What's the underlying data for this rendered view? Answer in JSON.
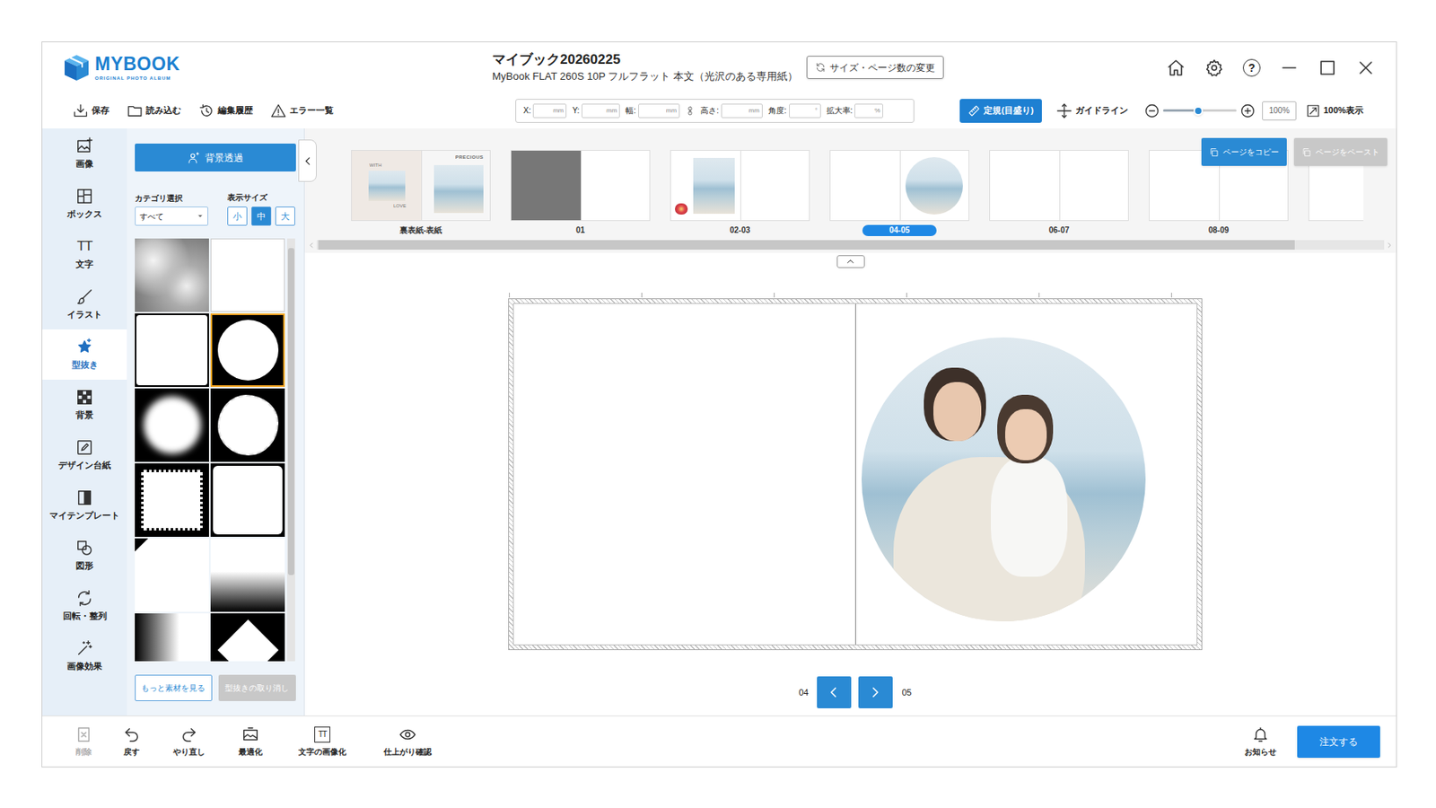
{
  "app": {
    "logo": "MYBOOK",
    "tagline": "ORIGINAL PHOTO ALBUM"
  },
  "window": {
    "title": "マイブック20260225",
    "subtitle": "MyBook FLAT 260S 10P フルフラット 本文（光沢のある専用紙）",
    "resize_button": "サイズ・ページ数の変更",
    "help": "?"
  },
  "toolbar": {
    "actions": [
      {
        "label": "保存",
        "kind": "save"
      },
      {
        "label": "読み込む",
        "kind": "open"
      },
      {
        "label": "編集履歴",
        "kind": "history"
      },
      {
        "label": "エラー一覧",
        "kind": "error"
      }
    ],
    "fields": [
      {
        "label": "X:",
        "unit": "mm",
        "value": ""
      },
      {
        "label": "Y:",
        "unit": "mm",
        "value": ""
      },
      {
        "label": "幅:",
        "unit": "mm",
        "value": ""
      },
      {
        "label": "高さ:",
        "unit": "mm",
        "value": ""
      },
      {
        "label": "角度:",
        "unit": "°",
        "value": ""
      },
      {
        "label": "拡大率:",
        "unit": "%",
        "value": ""
      }
    ],
    "ruler": {
      "label": "定規(目盛り)",
      "on": true
    },
    "guide": {
      "label": "ガイドライン"
    },
    "zoom": {
      "level": 0.48,
      "value": "100%",
      "fit_label": "100%表示"
    }
  },
  "sidebar": {
    "items": [
      {
        "label": "画像",
        "kind": "image",
        "selected": false
      },
      {
        "label": "ボックス",
        "kind": "box",
        "selected": false
      },
      {
        "label": "文字",
        "kind": "text",
        "glyph": "TT",
        "selected": false
      },
      {
        "label": "イラスト",
        "kind": "illust",
        "selected": false
      },
      {
        "label": "型抜き",
        "kind": "mask",
        "selected": true
      },
      {
        "label": "背景",
        "kind": "background",
        "selected": false
      },
      {
        "label": "デザイン台紙",
        "kind": "design",
        "selected": false
      },
      {
        "label": "マイテンプレート",
        "kind": "template",
        "selected": false
      },
      {
        "label": "図形",
        "kind": "shape",
        "selected": false
      },
      {
        "label": "回転・整列",
        "kind": "rotate",
        "selected": false
      },
      {
        "label": "画像効果",
        "kind": "effect",
        "selected": false
      }
    ]
  },
  "panel": {
    "transparent_button": "背景透過",
    "category_label": "カテゴリ選択",
    "category_value": "すべて",
    "size_label": "表示サイズ",
    "sizes": [
      {
        "label": "小",
        "selected": false
      },
      {
        "label": "中",
        "selected": true
      },
      {
        "label": "大",
        "selected": false
      }
    ],
    "masks": [
      {
        "kind": "cloud",
        "selected": false
      },
      {
        "kind": "plain",
        "selected": false
      },
      {
        "kind": "rounded",
        "selected": false
      },
      {
        "kind": "circle",
        "selected": true
      },
      {
        "kind": "soft-circle",
        "selected": false
      },
      {
        "kind": "rough-circle",
        "selected": false
      },
      {
        "kind": "stamp",
        "selected": false
      },
      {
        "kind": "rounded-frame",
        "selected": false
      },
      {
        "kind": "notch",
        "selected": false
      },
      {
        "kind": "fade-bottom",
        "selected": false
      },
      {
        "kind": "fade-left",
        "selected": false
      },
      {
        "kind": "diamond",
        "selected": false
      }
    ],
    "more_button": "もっと素材を見る",
    "undo_button": {
      "label": "型抜きの取り消し",
      "disabled": true
    }
  },
  "pages": {
    "copy": {
      "label": "ページをコピー",
      "disabled": false
    },
    "paste": {
      "label": "ページをペースト",
      "disabled": true
    },
    "thumbs": [
      {
        "label": "裏表紙-表紙",
        "kind": "cover",
        "captions": [
          "WITH",
          "LOVE",
          "PRECIOUS"
        ],
        "selected": false
      },
      {
        "label": "01",
        "kind": "dark-left",
        "selected": false
      },
      {
        "label": "02-03",
        "kind": "photo",
        "selected": false
      },
      {
        "label": "04-05",
        "kind": "circle",
        "selected": true
      },
      {
        "label": "06-07",
        "kind": "blank",
        "selected": false
      },
      {
        "label": "08-09",
        "kind": "blank",
        "selected": false
      },
      {
        "kind": "blank",
        "selected": false
      }
    ]
  },
  "canvas": {
    "photo": {
      "mask": "circle"
    },
    "left_page": "04",
    "right_page": "05"
  },
  "bottom": {
    "actions": [
      {
        "label": "削除",
        "kind": "delete",
        "disabled": true
      },
      {
        "label": "戻す",
        "kind": "undo",
        "disabled": false
      },
      {
        "label": "やり直し",
        "kind": "redo",
        "disabled": false
      },
      {
        "label": "最適化",
        "kind": "optimize",
        "disabled": false
      },
      {
        "label": "文字の画像化",
        "kind": "text-image",
        "glyph": "TT",
        "disabled": false
      },
      {
        "label": "仕上がり確認",
        "kind": "preview",
        "disabled": false
      }
    ],
    "notice": "お知らせ",
    "order": "注文する"
  }
}
